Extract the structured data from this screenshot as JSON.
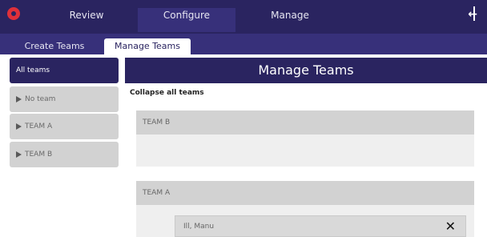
{
  "nav": {
    "tabs": [
      {
        "label": "Review"
      },
      {
        "label": "Configure"
      },
      {
        "label": "Manage"
      }
    ]
  },
  "subnav": {
    "tabs": [
      {
        "label": "Create Teams"
      },
      {
        "label": "Manage Teams"
      }
    ]
  },
  "sidebar": {
    "items": [
      {
        "label": "All teams"
      },
      {
        "label": "No team"
      },
      {
        "label": "TEAM A"
      },
      {
        "label": "TEAM B"
      }
    ]
  },
  "panel": {
    "title": "Manage Teams",
    "collapse_label": "Collapse all teams",
    "teams": [
      {
        "name": "TEAM B"
      },
      {
        "name": "TEAM A",
        "members": [
          {
            "name": "Ill, Manu"
          }
        ]
      }
    ]
  },
  "colors": {
    "nav_bg": "#2a2460",
    "subnav_bg": "#37307a",
    "logo": "#e0303a",
    "item_bg": "#d2d2d2"
  }
}
